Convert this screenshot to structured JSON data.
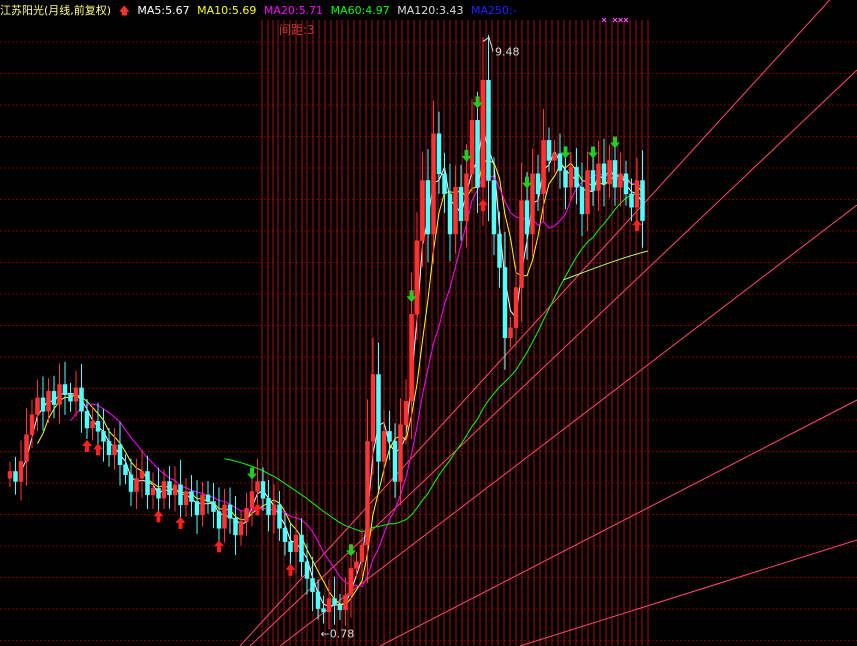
{
  "title": "江苏阳光(月线,前复权)",
  "indicators": [
    {
      "label": "MA5:5.67",
      "color": "#ffffff"
    },
    {
      "label": "MA10:5.69",
      "color": "#ffff00"
    },
    {
      "label": "MA20:5.71",
      "color": "#ff00ff"
    },
    {
      "label": "MA60:4.97",
      "color": "#00ff00"
    },
    {
      "label": "MA120:3.43",
      "color": "#dddddd"
    },
    {
      "label": "MA250:-",
      "color": "#2222ff"
    }
  ],
  "spacing_label": "间距:3",
  "colors": {
    "up": "#ff3333",
    "down": "#54ffff",
    "grid": "#7a0000",
    "vline": "#a01010",
    "channel": "#ff4a6c",
    "buy_signal": "#ff2020",
    "sell_signal": "#22cc22"
  },
  "chart_data": {
    "type": "candlestick",
    "ylim": [
      0.5,
      9.8
    ],
    "high_marker": {
      "label": "9.48",
      "value": 9.48,
      "index": 86
    },
    "low_marker": {
      "label": "←0.78",
      "value": 0.78,
      "index": 57
    },
    "closes": [
      3.05,
      2.9,
      3.2,
      3.6,
      3.9,
      4.15,
      3.95,
      4.25,
      4.05,
      4.35,
      4.2,
      4.1,
      4.3,
      3.95,
      3.7,
      3.8,
      3.65,
      3.5,
      3.3,
      3.45,
      3.15,
      3.0,
      2.75,
      2.95,
      3.05,
      2.7,
      2.8,
      2.65,
      2.9,
      2.7,
      2.85,
      2.55,
      2.75,
      2.6,
      2.4,
      2.7,
      2.6,
      2.45,
      2.2,
      2.55,
      2.35,
      2.1,
      2.3,
      2.5,
      2.75,
      2.9,
      2.65,
      2.4,
      2.55,
      2.2,
      2.0,
      1.85,
      2.1,
      1.7,
      1.45,
      1.25,
      1.0,
      0.95,
      1.15,
      1.05,
      0.98,
      1.2,
      1.6,
      1.7,
      1.95,
      3.5,
      4.5,
      3.2,
      3.65,
      3.5,
      2.9,
      3.75,
      4.1,
      5.4,
      6.5,
      7.4,
      6.6,
      8.1,
      7.5,
      7.2,
      6.6,
      7.3,
      6.8,
      7.5,
      8.3,
      7.3,
      8.9,
      7.4,
      6.6,
      6.1,
      5.05,
      5.2,
      5.8,
      7.1,
      6.6,
      7.5,
      7.2,
      8.0,
      7.7,
      7.8,
      7.55,
      7.3,
      7.6,
      7.3,
      6.9,
      7.55,
      7.25,
      7.65,
      7.35,
      7.7,
      7.3,
      7.5,
      7.2,
      7.0,
      7.4,
      6.8
    ],
    "arrows_up": [
      14,
      16,
      27,
      31,
      38,
      45,
      51,
      86,
      114
    ],
    "arrows_down": [
      44,
      62,
      73,
      83,
      85,
      94,
      101,
      106,
      110
    ],
    "crosses": [
      108,
      110,
      111,
      112
    ],
    "vlines": [
      262,
      268,
      273,
      278,
      284,
      290,
      296,
      302,
      307,
      313,
      319,
      325,
      331,
      337,
      342,
      348,
      354,
      360,
      366,
      372,
      378,
      384,
      390,
      396,
      402,
      408,
      414,
      420,
      426,
      432,
      438,
      444,
      450,
      456,
      462,
      468,
      474,
      480,
      486,
      492,
      498,
      504,
      510,
      516,
      522,
      528,
      534,
      540,
      546,
      552,
      558,
      564,
      570,
      576,
      582,
      588,
      594,
      600,
      606,
      612,
      618,
      624,
      630,
      636,
      642,
      648
    ]
  }
}
